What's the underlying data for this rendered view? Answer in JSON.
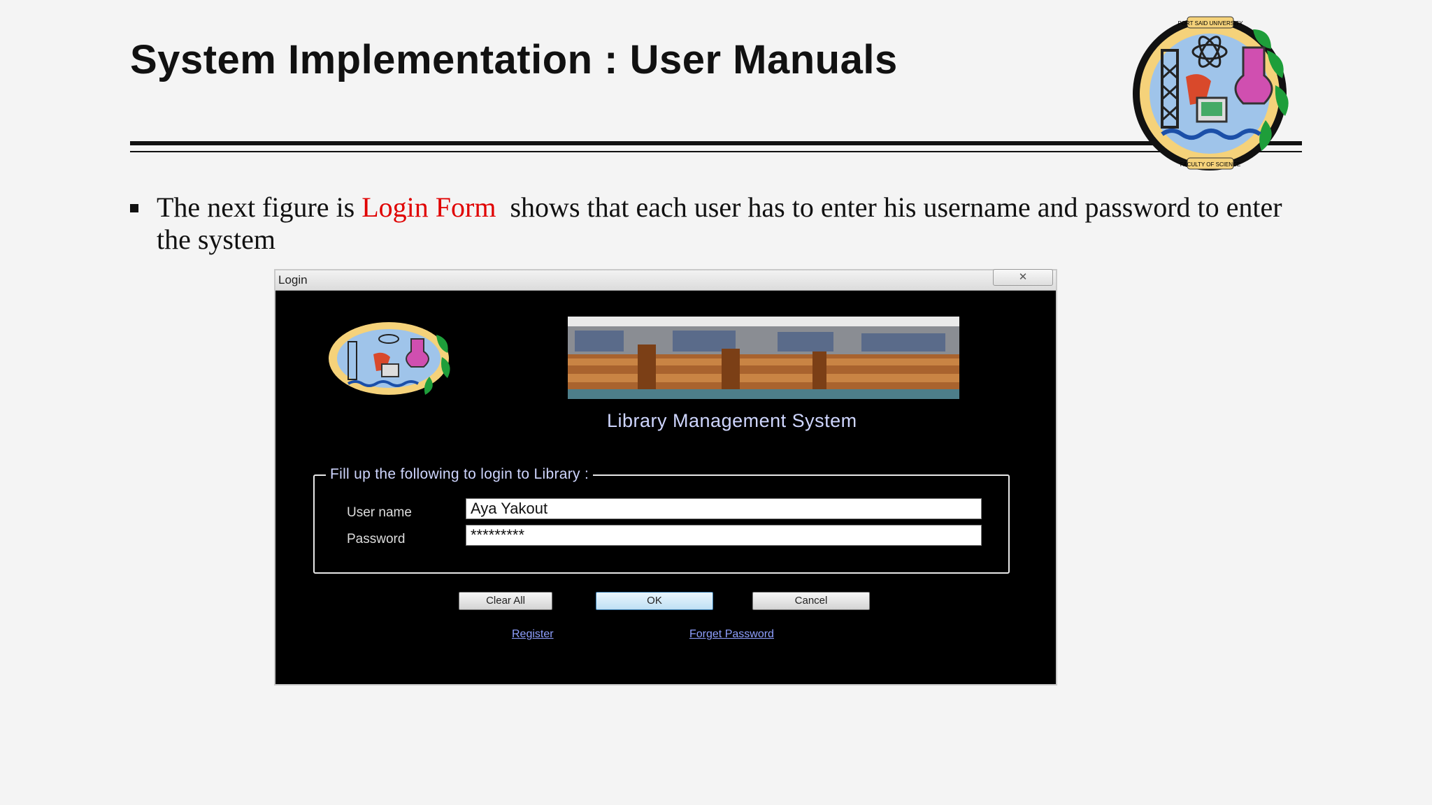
{
  "slide": {
    "title": "System Implementation : User Manuals",
    "bullet_pre": "The next figure is ",
    "bullet_highlight": "Login Form",
    "bullet_post": "  shows that each user has to enter his username and password to enter the system"
  },
  "logo": {
    "top_text": "PORT SAID UNIVERSITY",
    "bottom_text": "FACULTY OF SCIENCE"
  },
  "dialog": {
    "title": "Login",
    "close_glyph": "✕",
    "system_name": "Library Management System",
    "group_legend": "Fill up the following to login to Library :",
    "username_label": "User name",
    "username_value": "Aya Yakout",
    "password_label": "Password",
    "password_value": "*********",
    "buttons": {
      "clear": "Clear All",
      "ok": "OK",
      "cancel": "Cancel"
    },
    "links": {
      "register": "Register",
      "forgot": "Forget Password"
    }
  },
  "colors": {
    "highlight": "#e00000",
    "dialog_bg": "#000000",
    "accent_text": "#cfd6ff"
  }
}
